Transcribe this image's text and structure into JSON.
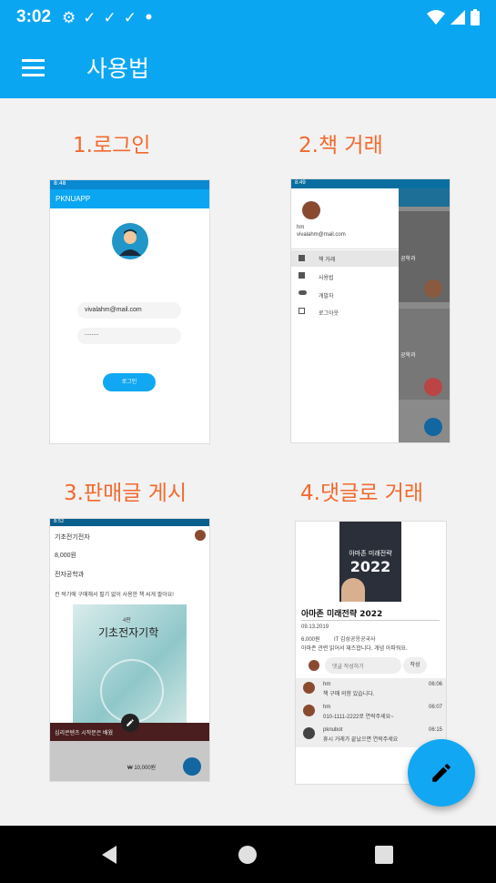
{
  "status": {
    "time": "3:02"
  },
  "appbar": {
    "title": "사용법"
  },
  "sections": [
    {
      "title": "1.로그인"
    },
    {
      "title": "2.책 거래"
    },
    {
      "title": "3.판매글 게시"
    },
    {
      "title": "4.댓글로 거래"
    }
  ],
  "login_shot": {
    "status_time": "8:48",
    "app_title": "PKNUAPP",
    "email": "vivalahm@mail.com",
    "password": "........",
    "login_button": "로그인"
  },
  "trade_shot": {
    "status_time": "8:49",
    "user_name": "hm",
    "user_email": "vivalahm@mail.com",
    "menu_items": [
      "책 거래",
      "사용법",
      "개발자",
      "로그아웃"
    ],
    "side_label_1": "공학과",
    "side_label_2": "공학과"
  },
  "post_shot": {
    "status_time": "8:52",
    "lines": [
      "기초전기전자",
      "8,000원",
      "전자공학과",
      "컨 싹기에 구매해서 필기 없이 사용한 책 씨게 팔아요!"
    ],
    "book_label": "4판",
    "book_title": "기초전자기학",
    "bottom_caption": "심리콘텐츠 시작문은 배웠",
    "price_label": "₩ 10,000원"
  },
  "comment_shot": {
    "cover_title": "아마존 미래전략",
    "cover_year": "2022",
    "book_title": "아마존 미래전략 2022",
    "date": "09.13.2019",
    "price": "6,000원",
    "dept": "IT 김성공응공국사",
    "desc": "아마존 관련 읽어서 재즈합니다. 개념 아파워요.",
    "comment_placeholder": "댓글 작성하기",
    "comment_button": "작성",
    "comments": [
      {
        "name": "hm",
        "text": "책 구매 의향 있습니다.",
        "time": "06:06"
      },
      {
        "name": "hm",
        "text": "010-1111-2222로 연락주세요~",
        "time": "06:07"
      },
      {
        "name": "pknubot",
        "text": "휴시 거래가 끝났으면 연락주세요",
        "time": "06:15"
      }
    ]
  },
  "colors": {
    "primary": "#0aa6f2",
    "accent": "#f26a2e",
    "fab": "#11a7f3"
  },
  "icons": {
    "fab": "pencil-icon",
    "menu": "menu-icon"
  }
}
